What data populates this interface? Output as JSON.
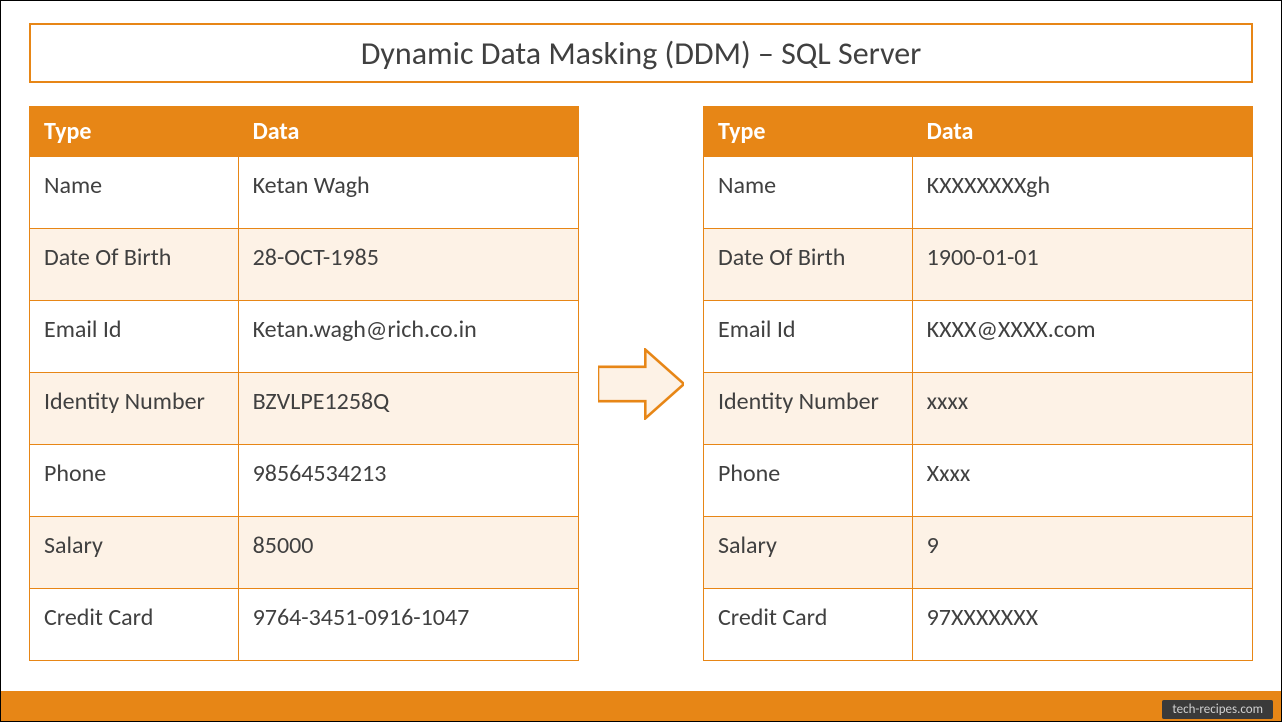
{
  "title": "Dynamic Data Masking (DDM) – SQL Server",
  "headers": {
    "type": "Type",
    "data": "Data"
  },
  "left_table": {
    "rows": [
      {
        "type": "Name",
        "data": "Ketan Wagh"
      },
      {
        "type": "Date Of Birth",
        "data": "28-OCT-1985"
      },
      {
        "type": "Email Id",
        "data": "Ketan.wagh@rich.co.in"
      },
      {
        "type": "Identity Number",
        "data": "BZVLPE1258Q"
      },
      {
        "type": "Phone",
        "data": "98564534213"
      },
      {
        "type": "Salary",
        "data": "85000"
      },
      {
        "type": "Credit Card",
        "data": "9764-3451-0916-1047"
      }
    ]
  },
  "right_table": {
    "rows": [
      {
        "type": "Name",
        "data": "KXXXXXXXgh"
      },
      {
        "type": "Date Of Birth",
        "data": "1900-01-01"
      },
      {
        "type": "Email Id",
        "data": "KXXX@XXXX.com"
      },
      {
        "type": "Identity Number",
        "data": "xxxx"
      },
      {
        "type": "Phone",
        "data": "Xxxx"
      },
      {
        "type": "Salary",
        "data": "9"
      },
      {
        "type": "Credit Card",
        "data": "97XXXXXXX"
      }
    ]
  },
  "footer": {
    "source": "tech-recipes.com"
  },
  "colors": {
    "accent": "#e78616"
  }
}
